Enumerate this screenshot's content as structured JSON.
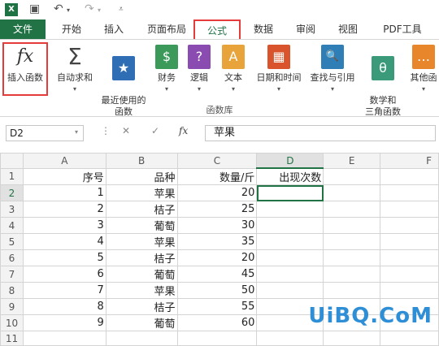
{
  "app": {
    "logo": "X"
  },
  "tabs": [
    {
      "label": "文件"
    },
    {
      "label": "开始"
    },
    {
      "label": "插入"
    },
    {
      "label": "页面布局"
    },
    {
      "label": "公式"
    },
    {
      "label": "数据"
    },
    {
      "label": "审阅"
    },
    {
      "label": "视图"
    },
    {
      "label": "PDF工具"
    }
  ],
  "ribbon": {
    "buttons": [
      {
        "label": "插入函数",
        "icon": "fx",
        "color": "#ffffff"
      },
      {
        "label": "自动求和",
        "icon": "Σ",
        "color": "#ffffff"
      },
      {
        "label": "最近使用的\n函数",
        "icon": "★",
        "color": "#2f6db5"
      },
      {
        "label": "财务",
        "icon": "$",
        "color": "#3b9a5a"
      },
      {
        "label": "逻辑",
        "icon": "?",
        "color": "#8a4cb0"
      },
      {
        "label": "文本",
        "icon": "A",
        "color": "#e8a33b"
      },
      {
        "label": "日期和时间",
        "icon": "▦",
        "color": "#d9542c"
      },
      {
        "label": "查找与引用",
        "icon": "🔍",
        "color": "#2f7fb6"
      },
      {
        "label": "数学和\n三角函数",
        "icon": "θ",
        "color": "#3b9a7a"
      },
      {
        "label": "其他函",
        "icon": "…",
        "color": "#e8862c"
      }
    ],
    "group_label": "函数库"
  },
  "formula_bar": {
    "name_box": "D2",
    "cancel": "✕",
    "enter": "✓",
    "fx": "fx",
    "value": "苹果"
  },
  "sheet": {
    "col_headers": [
      "A",
      "B",
      "C",
      "D",
      "E",
      "F"
    ],
    "row_headers": [
      "1",
      "2",
      "3",
      "4",
      "5",
      "6",
      "7",
      "8",
      "9",
      "10",
      "11"
    ],
    "rows": [
      [
        "序号",
        "品种",
        "数量/斤",
        "出现次数",
        "",
        ""
      ],
      [
        "1",
        "苹果",
        "20",
        "",
        "",
        ""
      ],
      [
        "2",
        "桔子",
        "25",
        "",
        "",
        ""
      ],
      [
        "3",
        "葡萄",
        "30",
        "",
        "",
        ""
      ],
      [
        "4",
        "苹果",
        "35",
        "",
        "",
        ""
      ],
      [
        "5",
        "桔子",
        "20",
        "",
        "",
        ""
      ],
      [
        "6",
        "葡萄",
        "45",
        "",
        "",
        ""
      ],
      [
        "7",
        "苹果",
        "50",
        "",
        "",
        ""
      ],
      [
        "8",
        "桔子",
        "55",
        "",
        "",
        ""
      ],
      [
        "9",
        "葡萄",
        "60",
        "",
        "",
        ""
      ],
      [
        "",
        "",
        "",
        "",
        "",
        ""
      ]
    ]
  },
  "watermark": "UiBQ.CoM"
}
